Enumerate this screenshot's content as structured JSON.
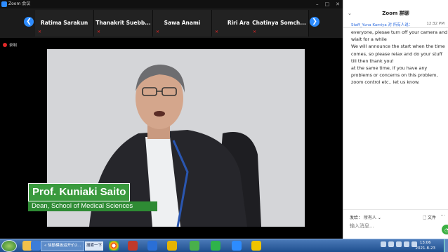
{
  "window": {
    "title": "Zoom 会议",
    "controls": [
      "–",
      "□",
      "✕"
    ]
  },
  "gallery": {
    "prev_icon": "chevron-left-icon",
    "next_icon": "chevron-right-icon",
    "participants": [
      {
        "name": "Ratima Sarakun"
      },
      {
        "name": "Thanakrit   Suebb..."
      },
      {
        "name": "Sawa Anami"
      },
      {
        "name": "Riri Araki"
      },
      {
        "name": "Chatinya   Somch..."
      }
    ]
  },
  "recording": {
    "label": "录制"
  },
  "speaker": {
    "name": "Prof. Kuniaki Saito",
    "title": "Dean, School of Medical Sciences"
  },
  "chat": {
    "title": "Zoom 群聊",
    "minimize": "⌄",
    "message": {
      "sender": "Staff_Yuna Kamiya 对 所有人说：",
      "time": "12:32 PM",
      "lines": [
        "everyone, plesae turn off your camera and",
        "wiait for  a while",
        "We will announce the start when the time",
        "comes, so please relax and do your stuff",
        "till then thank you!",
        "at the same time, if you have any",
        "problems or concerns on this problem,",
        "zoom control etc.. let us know."
      ]
    },
    "to_label": "发给：",
    "to_value": "所有人 ⌄",
    "file_label": "文件",
    "more": "···",
    "input_placeholder": "输入消息..."
  },
  "taskbar": {
    "task_label": "« 徐勤模板运开价2...",
    "search_label": "搜索一下",
    "time": "13:06",
    "date": "2021-8-23"
  },
  "colors": {
    "zoom_blue": "#2d8cff",
    "lower_third_green": "#3a9a3e",
    "record_red": "#e02828"
  }
}
